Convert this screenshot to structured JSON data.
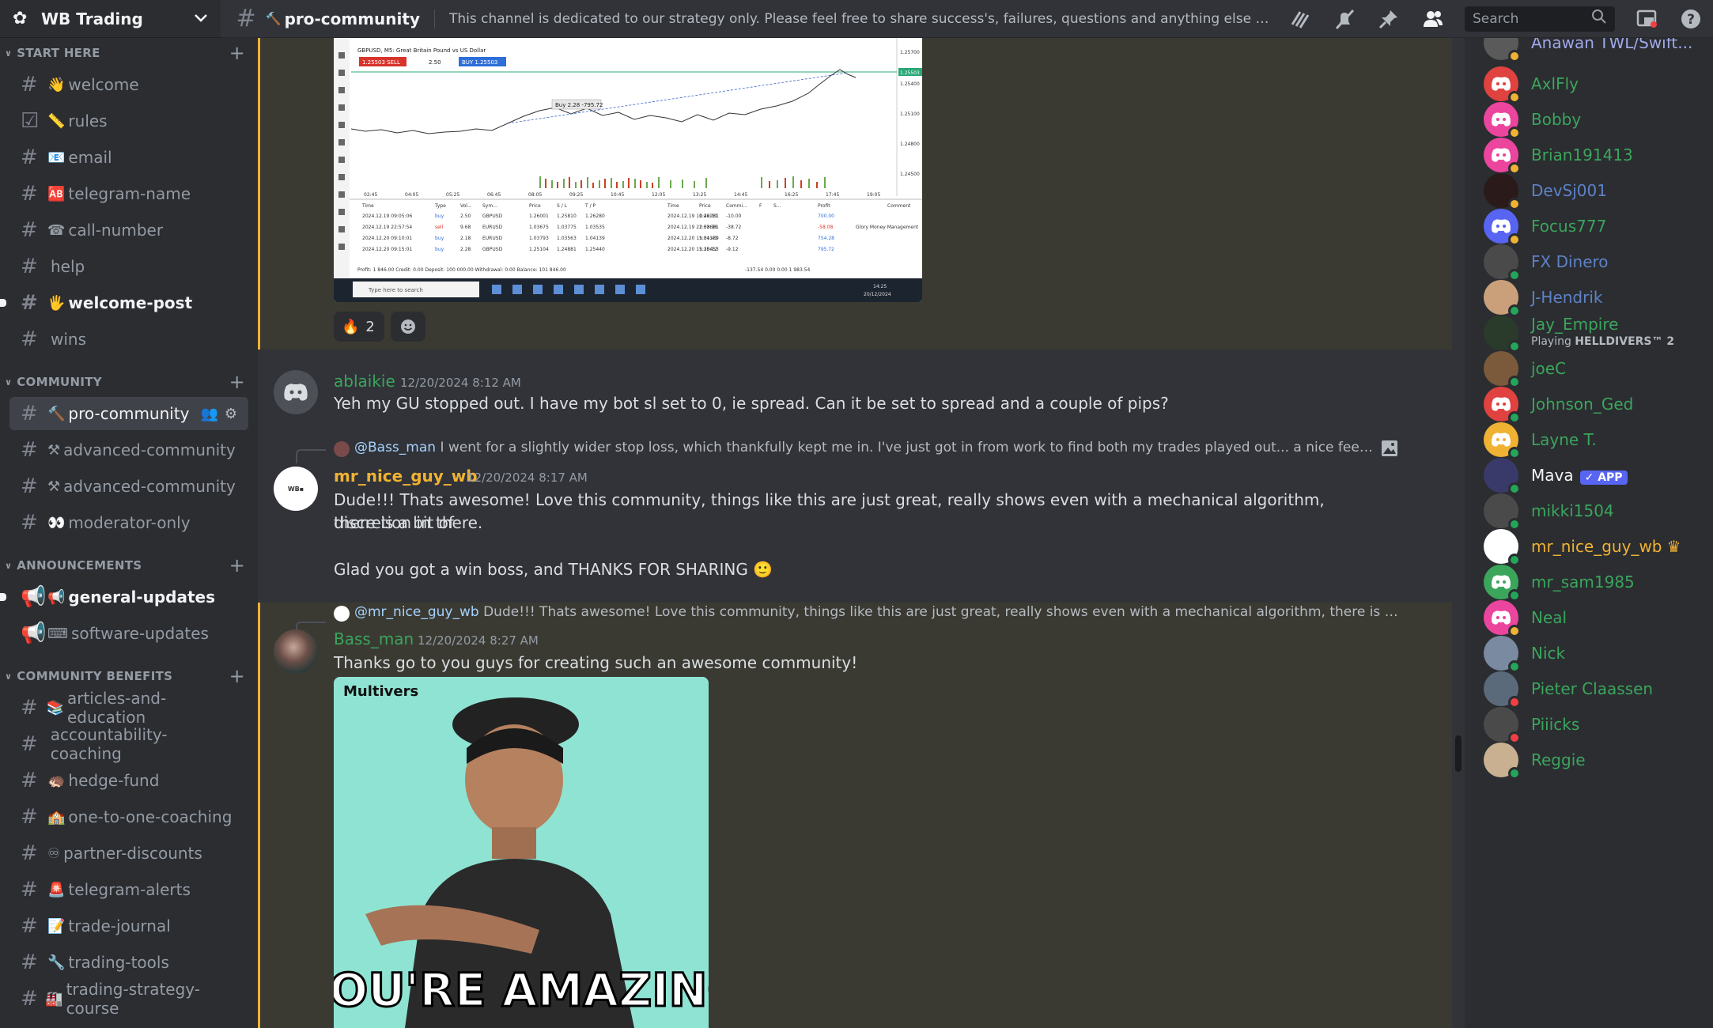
{
  "server": {
    "name": "WB Trading"
  },
  "header": {
    "channel_emoji": "🔨",
    "channel_name": "pro-community",
    "topic": "This channel is dedicated to our strategy only. Please feel free to share success's, failures, questions and anything else relat...",
    "search_placeholder": "Search"
  },
  "sidebar": {
    "categories": [
      {
        "label": "START HERE",
        "channels": [
          {
            "emoji": "👋",
            "name": "welcome"
          },
          {
            "emoji": "📏",
            "name": "rules"
          },
          {
            "emoji": "📧",
            "name": "email"
          },
          {
            "emoji": "🆎",
            "name": "telegram-name"
          },
          {
            "emoji": "☎",
            "name": "call-number"
          },
          {
            "emoji": "",
            "name": "help"
          },
          {
            "emoji": "🖐",
            "name": "welcome-post"
          },
          {
            "emoji": "",
            "name": "wins"
          }
        ]
      },
      {
        "label": "COMMUNITY",
        "channels": [
          {
            "emoji": "🔨",
            "name": "pro-community"
          },
          {
            "emoji": "⚒",
            "name": "advanced-community"
          },
          {
            "emoji": "⚒",
            "name": "advanced-community"
          },
          {
            "emoji": "👀",
            "name": "moderator-only"
          }
        ]
      },
      {
        "label": "ANNOUNCEMENTS",
        "channels": [
          {
            "emoji": "📢",
            "name": "general-updates"
          },
          {
            "emoji": "⌨",
            "name": "software-updates"
          }
        ]
      },
      {
        "label": "COMMUNITY BENEFITS",
        "channels": [
          {
            "emoji": "📚",
            "name": "articles-and-education"
          },
          {
            "emoji": "",
            "name": "accountability-coaching"
          },
          {
            "emoji": "🦔",
            "name": "hedge-fund"
          },
          {
            "emoji": "🏫",
            "name": "one-to-one-coaching"
          },
          {
            "emoji": "♾",
            "name": "partner-discounts"
          },
          {
            "emoji": "🚨",
            "name": "telegram-alerts"
          },
          {
            "emoji": "📝",
            "name": "trade-journal"
          },
          {
            "emoji": "🔧",
            "name": "trading-tools"
          },
          {
            "emoji": "🏭",
            "name": "trading-strategy-course"
          }
        ]
      }
    ]
  },
  "chart_screenshot": {
    "title": "GBPUSD, M5: Great Britain Pound vs US Dollar",
    "sell_label": "1.25503 SELL",
    "lot": "2.50",
    "buy_label": "BUY 1.25503",
    "tooltip": "Buy 2.28 -795.72",
    "price_ticks": [
      "1.25700",
      "1.25503",
      "1.25400",
      "1.25100",
      "1.24800",
      "1.24500"
    ],
    "time_ticks": [
      "02:45",
      "04:05",
      "05:25",
      "06:45",
      "08:05",
      "09:25",
      "10:45",
      "12:05",
      "13:25",
      "14:45",
      "16:25",
      "17:45",
      "19:05"
    ],
    "table_headers": [
      "Time",
      "Type",
      "Vol...",
      "Sym...",
      "Price",
      "S / L",
      "T / P",
      "Time",
      "Price",
      "Commi...",
      "F",
      "S...",
      "Profit",
      "Comment"
    ],
    "table_rows": [
      [
        "2024.12.19 09:05:06",
        "buy",
        "2.50",
        "GBPUSD",
        "1.26001",
        "1.25810",
        "1.26280",
        "2024.12.19 10:42:10",
        "1.26281",
        "-10.00",
        "",
        "",
        "700.00",
        ""
      ],
      [
        "2024.12.19 22:57:54",
        "sell",
        "9.68",
        "EURUSD",
        "1.03675",
        "1.03775",
        "1.03535",
        "2024.12.19 22:58:36",
        "1.03681",
        "-38.72",
        "",
        "",
        "-58.08",
        "Glory Money Management"
      ],
      [
        "2024.12.20 09:10:01",
        "buy",
        "2.18",
        "EURUSD",
        "1.03793",
        "1.03563",
        "1.04139",
        "2024.12.20 15:31:43",
        "1.04139",
        "-8.72",
        "",
        "",
        "754.28",
        ""
      ],
      [
        "2024.12.20 09:15:01",
        "buy",
        "2.28",
        "GBPUSD",
        "1.25104",
        "1.24881",
        "1.25440",
        "2024.12.20 15:30:12",
        "1.25453",
        "-9.12",
        "",
        "",
        "795.72",
        ""
      ]
    ],
    "footer": "Profit: 1 846.00   Credit: 0.00   Deposit: 100 000.00   Withdrawal: 0.00   Balance: 101 846.00",
    "footer_totals": "-137.54   0.00   0.00   1 983.54",
    "taskbar_search": "Type here to search",
    "taskbar_time": "14:25",
    "taskbar_date": "20/12/2024"
  },
  "reactions": [
    {
      "emoji": "🔥",
      "count": "2"
    }
  ],
  "messages": [
    {
      "author": "ablaikie",
      "timestamp": "12/20/2024 8:12 AM",
      "text": "Yeh my GU stopped out. I have my bot sl set to 0, ie spread. Can it be set to spread and a couple of pips?"
    },
    {
      "reply_to": "@Bass_man",
      "reply_text": "I went for a slightly wider stop loss, which thankfully kept me in. I've just got in from work to find both my trades played out... a nice feeling going in...",
      "author": "mr_nice_guy_wb",
      "timestamp": "12/20/2024 8:17 AM",
      "text1": "Dude!!! Thats awesome! Love this community, things like this are just great, really shows even with a mechanical algorithm, there is a bit of",
      "text2": "discretion in there.",
      "text3": "Glad you got a win boss, and THANKS FOR SHARING 🙂"
    },
    {
      "reply_to": "@mr_nice_guy_wb",
      "reply_text": "Dude!!! Thats awesome! Love this community, things like this are just great, really shows even with a mechanical algorithm, there is a bit of discr...",
      "author": "Bass_man",
      "timestamp": "12/20/2024 8:27 AM",
      "text": "Thanks go to you guys for creating such an awesome community!"
    }
  ],
  "gif": {
    "watermark": "Multivers",
    "caption": "YOU'RE AMAZING"
  },
  "members": [
    {
      "name": "Anawan TWL/Swift...",
      "color": "#a0a8e8"
    },
    {
      "name": "AxlFly",
      "color": "#3ba55c"
    },
    {
      "name": "Bobby",
      "color": "#3ba55c"
    },
    {
      "name": "Brian191413",
      "color": "#3ba55c"
    },
    {
      "name": "DevSj001",
      "color": "#5e82c7"
    },
    {
      "name": "Focus777",
      "color": "#3ba55c"
    },
    {
      "name": "FX Dinero",
      "color": "#5e82c7"
    },
    {
      "name": "J-Hendrik",
      "color": "#5e82c7"
    },
    {
      "name": "Jay_Empire",
      "color": "#3ba55c",
      "activity_prefix": "Playing ",
      "activity": "HELLDIVERS™ 2"
    },
    {
      "name": "joeC",
      "color": "#3ba55c"
    },
    {
      "name": "Johnson_Ged",
      "color": "#3ba55c"
    },
    {
      "name": "Layne T.",
      "color": "#3ba55c"
    },
    {
      "name": "Mava",
      "color": "#f2f3f5",
      "badge": "✓ APP"
    },
    {
      "name": "mikki1504",
      "color": "#3ba55c"
    },
    {
      "name": "mr_nice_guy_wb",
      "color": "#f0b232",
      "crown": "♛"
    },
    {
      "name": "mr_sam1985",
      "color": "#3ba55c"
    },
    {
      "name": "Neal",
      "color": "#3ba55c"
    },
    {
      "name": "Nick",
      "color": "#3ba55c"
    },
    {
      "name": "Pieter Claassen",
      "color": "#3ba55c"
    },
    {
      "name": "Piiicks",
      "color": "#3ba55c"
    },
    {
      "name": "Reggie",
      "color": "#3ba55c"
    }
  ],
  "colors": {
    "accent": "#5865f2",
    "highlight_border": "#f0b232",
    "online": "#23a55a",
    "idle": "#f0b232",
    "dnd": "#f23f43"
  }
}
